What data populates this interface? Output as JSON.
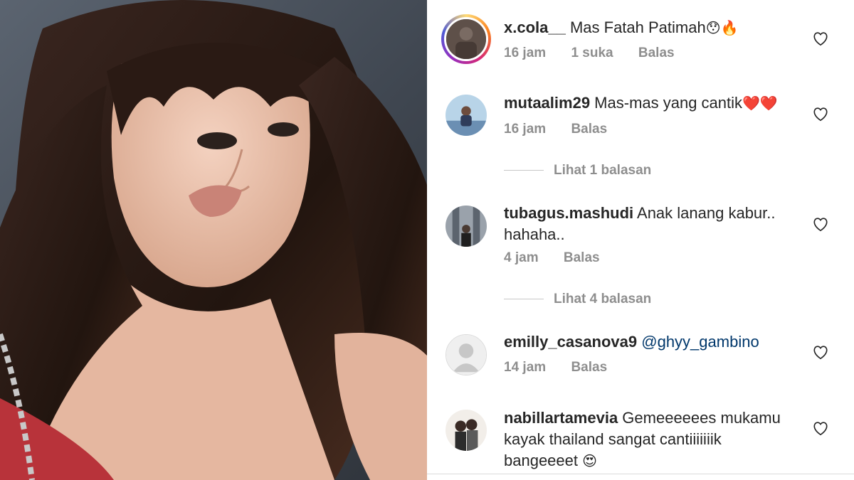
{
  "photo": {
    "alt": ""
  },
  "comments": [
    {
      "username": "x.cola__",
      "text": " Mas Fatah Patimah",
      "emoji": "😯🔥",
      "time": "16 jam",
      "likes": "1 suka",
      "reply": "Balas",
      "avatar": "story-avatar"
    },
    {
      "username": "mutaalim29",
      "text": " Mas-mas yang cantik",
      "emoji": "❤️❤️",
      "time": "16 jam",
      "reply": "Balas",
      "view_replies": "Lihat 1 balasan"
    },
    {
      "username": "tubagus.mashudi",
      "text": " Anak lanang kabur.. hahaha..",
      "time": "4 jam",
      "reply": "Balas",
      "view_replies": "Lihat 4 balasan"
    },
    {
      "username": "emilly_casanova9",
      "mention": " @ghyy_gambino",
      "time": "14 jam",
      "reply": "Balas",
      "avatar": "default-avatar"
    },
    {
      "username": "nabillartamevia",
      "text": " Gemeeeeees mukamu kayak thailand sangat cantiiiiiiik bangeeeet ",
      "emoji": "😍"
    }
  ],
  "icons": {
    "like": "heart-outline-icon"
  },
  "colors": {
    "text": "#262626",
    "meta": "#8e8e8e",
    "mention": "#00376b"
  }
}
